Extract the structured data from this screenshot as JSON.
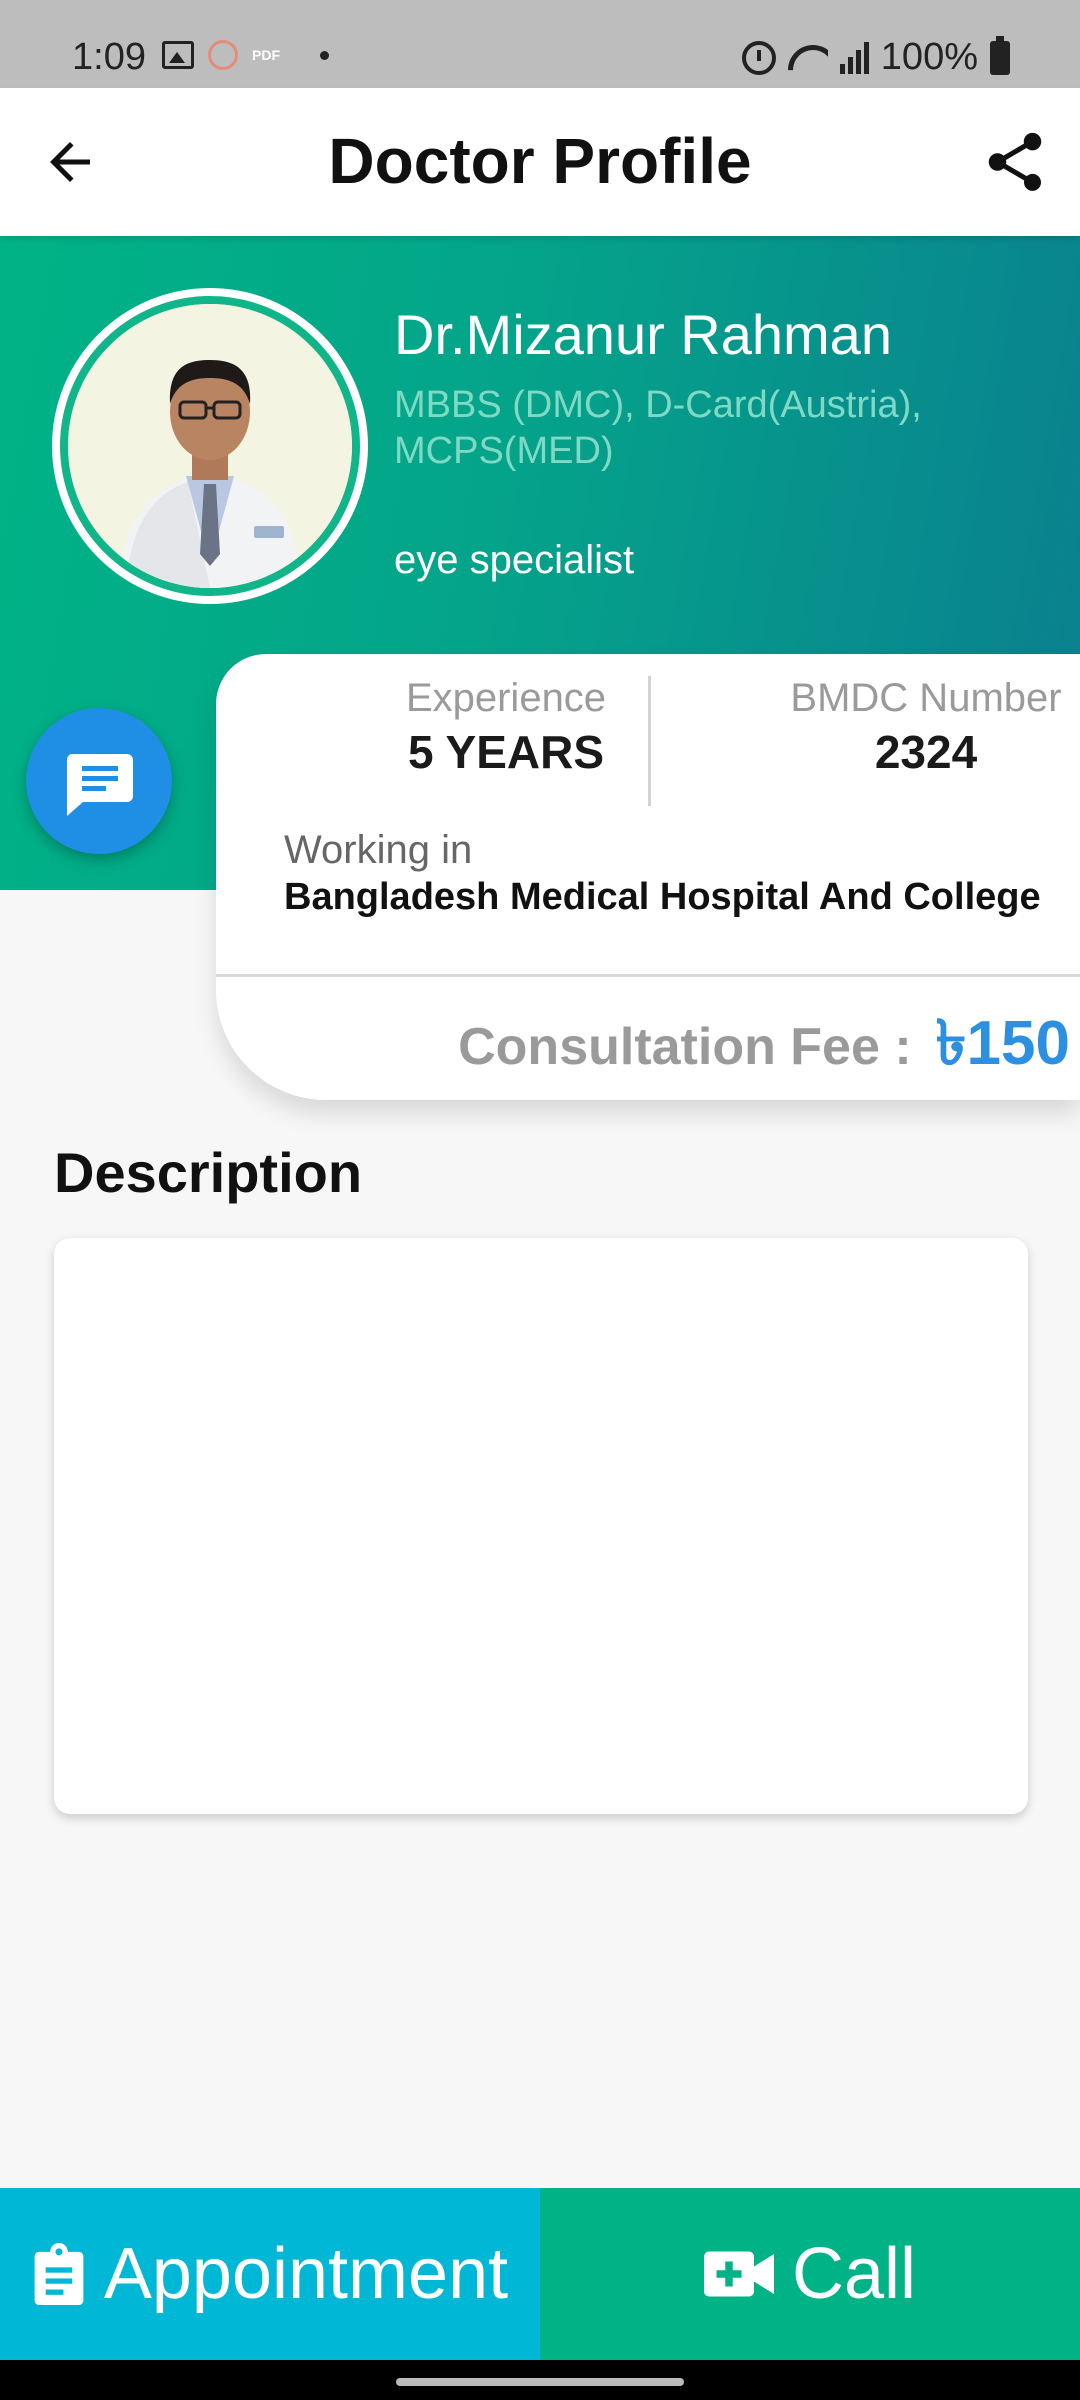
{
  "status_bar": {
    "time": "1:09",
    "pdf_label": "PDF",
    "battery": "100%"
  },
  "app_bar": {
    "title": "Doctor Profile",
    "back_icon": "arrow-left-icon",
    "share_icon": "share-icon"
  },
  "doctor": {
    "name": "Dr.Mizanur Rahman",
    "degrees": "MBBS (DMC), D-Card(Austria), MCPS(MED)",
    "specialty": "eye specialist"
  },
  "stats": {
    "experience_label": "Experience",
    "experience_value": "5 YEARS",
    "bmdc_label": "BMDC Number",
    "bmdc_value": "2324",
    "working_label": "Working in",
    "working_value": "Bangladesh Medical Hospital And College",
    "fee_label": "Consultation Fee :",
    "fee_value": "৳150"
  },
  "description": {
    "title": "Description",
    "body": ""
  },
  "actions": {
    "appointment_label": "Appointment",
    "call_label": "Call"
  },
  "colors": {
    "header_start": "#00b386",
    "header_end": "#0a7f8f",
    "fee_accent": "#2c8fe0",
    "appointment_bg": "#00b8d6",
    "call_bg": "#00b386",
    "fab_bg": "#1f8fe6"
  }
}
